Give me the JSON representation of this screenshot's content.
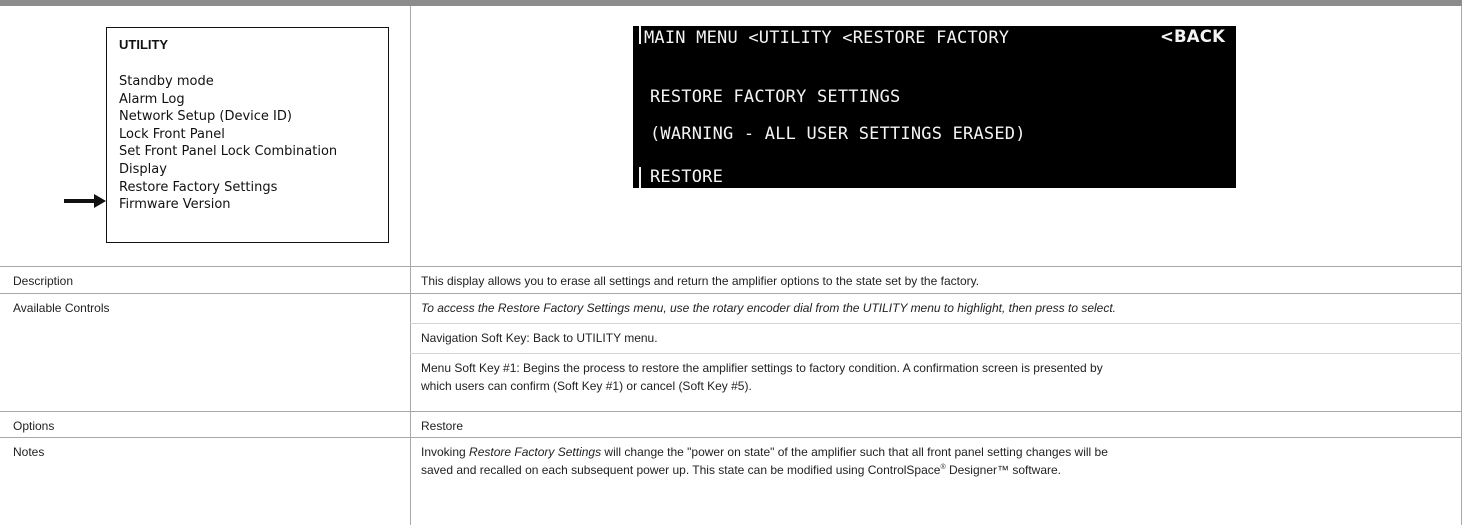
{
  "menu": {
    "title": "UTILITY",
    "items": [
      "Standby mode",
      "Alarm Log",
      "Network Setup (Device ID)",
      "Lock Front Panel",
      "Set Front Panel Lock Combination",
      "Display",
      "Restore Factory Settings",
      "Firmware Version"
    ],
    "selected_index": 6
  },
  "lcd": {
    "breadcrumb": "MAIN MENU <UTILITY <RESTORE FACTORY",
    "back_label": "<BACK",
    "line1": "RESTORE FACTORY SETTINGS",
    "line2": "(WARNING - ALL USER SETTINGS ERASED)",
    "softkey1": "RESTORE"
  },
  "rows": {
    "description": {
      "label": "Description",
      "value": "This display allows you to erase all settings and return the amplifier options to the state set by the factory."
    },
    "controls": {
      "label": "Available Controls",
      "access": "To access the Restore Factory Settings menu, use the rotary encoder dial from the UTILITY menu to highlight, then press to select.",
      "nav": "Navigation Soft Key: Back to UTILITY menu.",
      "menu_key_line1": "Menu Soft Key #1: Begins the process to restore the amplifier settings to factory condition. A confirmation screen is presented by",
      "menu_key_line2": "which users can confirm (Soft Key #1) or cancel (Soft Key #5)."
    },
    "options": {
      "label": "Options",
      "value": "Restore"
    },
    "notes": {
      "label": "Notes",
      "pre": "Invoking ",
      "em": "Restore Factory Settings",
      "post": " will change the \"power on state\" of the amplifier such that all front panel setting changes will be",
      "line2_pre": "saved and recalled on each subsequent power up. This state can be modified using ControlSpace",
      "reg": "®",
      "line2_post": " Designer™ software."
    }
  }
}
